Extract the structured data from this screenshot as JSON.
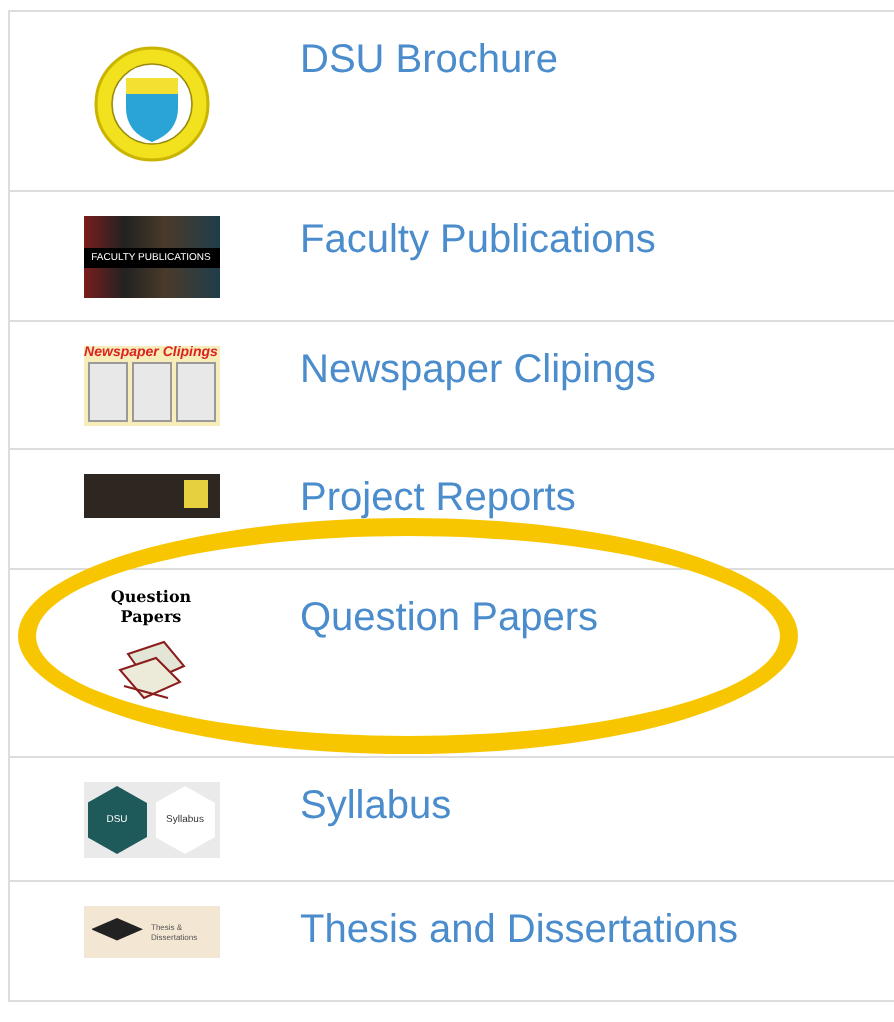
{
  "items": [
    {
      "kind": "seal",
      "label": "DSU Brochure",
      "highlighted": false
    },
    {
      "kind": "books",
      "label": "Faculty Publications",
      "thumb_text": [
        "FACULTY PUBLICATIONS"
      ],
      "highlighted": false
    },
    {
      "kind": "newspaper",
      "label": "Newspaper Clipings",
      "thumb_text": [
        "Newspaper Clipings"
      ],
      "highlighted": false
    },
    {
      "kind": "reports",
      "label": "Project Reports",
      "highlighted": false
    },
    {
      "kind": "papers",
      "label": "Question Papers",
      "thumb_text": [
        "Question",
        "Papers"
      ],
      "highlighted": true
    },
    {
      "kind": "syllabus",
      "label": "Syllabus",
      "thumb_text": [
        "DSU",
        "Syllabus"
      ],
      "highlighted": false
    },
    {
      "kind": "thesis",
      "label": "Thesis and Dissertations",
      "thumb_text": [
        "Thesis &",
        "Dissertations"
      ],
      "highlighted": false
    }
  ]
}
